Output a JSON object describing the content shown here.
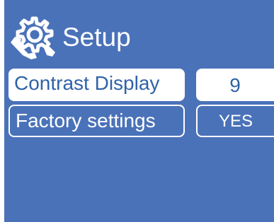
{
  "header": {
    "icon": "gear-icon",
    "title": "Setup"
  },
  "menu": {
    "items": [
      {
        "label": "Contrast Display",
        "value": "9",
        "selected": true
      },
      {
        "label": "Factory settings",
        "value": "YES",
        "selected": false
      }
    ]
  },
  "colors": {
    "background": "#4a72b9",
    "foreground": "#ffffff",
    "selected_text": "#2f63a8"
  }
}
